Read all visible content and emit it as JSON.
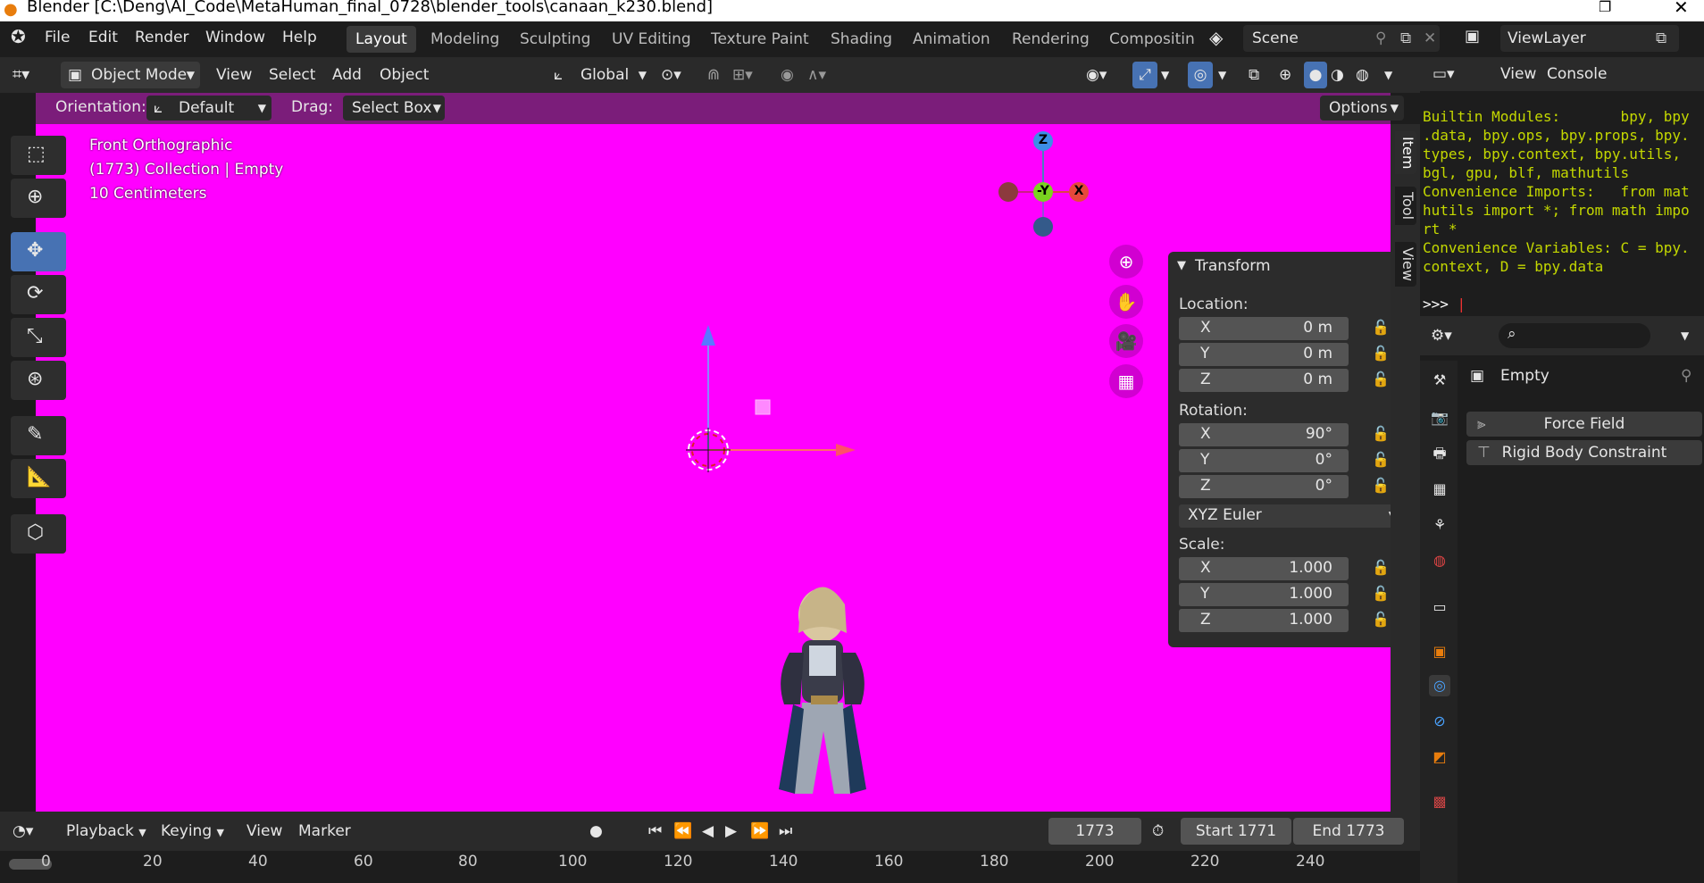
{
  "window": {
    "title": "Blender [C:\\Deng\\AI_Code\\MetaHuman_final_0728\\blender_tools\\canaan_k230.blend]"
  },
  "menu": {
    "file": "File",
    "edit": "Edit",
    "render": "Render",
    "window": "Window",
    "help": "Help"
  },
  "workspaces": [
    {
      "label": "Layout"
    },
    {
      "label": "Modeling"
    },
    {
      "label": "Sculpting"
    },
    {
      "label": "UV Editing"
    },
    {
      "label": "Texture Paint"
    },
    {
      "label": "Shading"
    },
    {
      "label": "Animation"
    },
    {
      "label": "Rendering"
    },
    {
      "label": "Compositin"
    }
  ],
  "scene": {
    "name": "Scene"
  },
  "viewlayer": {
    "name": "ViewLayer"
  },
  "header": {
    "mode": "Object Mode",
    "view": "View",
    "select": "Select",
    "add": "Add",
    "object": "Object",
    "transform_orientation": "Global"
  },
  "tool_header": {
    "orientation_label": "Orientation:",
    "orientation_value": "Default",
    "drag_label": "Drag:",
    "drag_value": "Select Box",
    "options": "Options"
  },
  "viewport": {
    "view_name": "Front Orthographic",
    "collection_info": "(1773) Collection | Empty",
    "scale_info": "10 Centimeters",
    "gizmo": {
      "z": "Z",
      "y": "-Y",
      "x": "X"
    },
    "background_color": "#ff00ff"
  },
  "npanel": {
    "title": "Transform",
    "location_label": "Location:",
    "location": [
      {
        "axis": "X",
        "value": "0 m"
      },
      {
        "axis": "Y",
        "value": "0 m"
      },
      {
        "axis": "Z",
        "value": "0 m"
      }
    ],
    "rotation_label": "Rotation:",
    "rotation": [
      {
        "axis": "X",
        "value": "90°"
      },
      {
        "axis": "Y",
        "value": "0°"
      },
      {
        "axis": "Z",
        "value": "0°"
      }
    ],
    "rotation_mode": "XYZ Euler",
    "scale_label": "Scale:",
    "scale": [
      {
        "axis": "X",
        "value": "1.000"
      },
      {
        "axis": "Y",
        "value": "1.000"
      },
      {
        "axis": "Z",
        "value": "1.000"
      }
    ]
  },
  "side_tabs": {
    "item": "Item",
    "tool": "Tool",
    "view": "View"
  },
  "timeline": {
    "playback": "Playback",
    "keying": "Keying",
    "view": "View",
    "marker": "Marker",
    "current_frame": "1773",
    "start": "Start 1771",
    "end": "End 1773",
    "ticks": [
      "0",
      "20",
      "40",
      "60",
      "80",
      "100",
      "120",
      "140",
      "160",
      "180",
      "200",
      "220",
      "240"
    ]
  },
  "console": {
    "view": "View",
    "console": "Console",
    "lines": [
      "Builtin Modules:       bpy, bpy",
      ".data, bpy.ops, bpy.props, bpy.",
      "types, bpy.context, bpy.utils,",
      "bgl, gpu, blf, mathutils",
      "Convenience Imports:   from mat",
      "hutils import *; from math impo",
      "rt *",
      "Convenience Variables: C = bpy.",
      "context, D = bpy.data"
    ],
    "prompt": ">>> "
  },
  "properties": {
    "object_name": "Empty",
    "buttons": [
      {
        "label": "Force Field"
      },
      {
        "label": "Rigid Body Constraint"
      }
    ]
  }
}
